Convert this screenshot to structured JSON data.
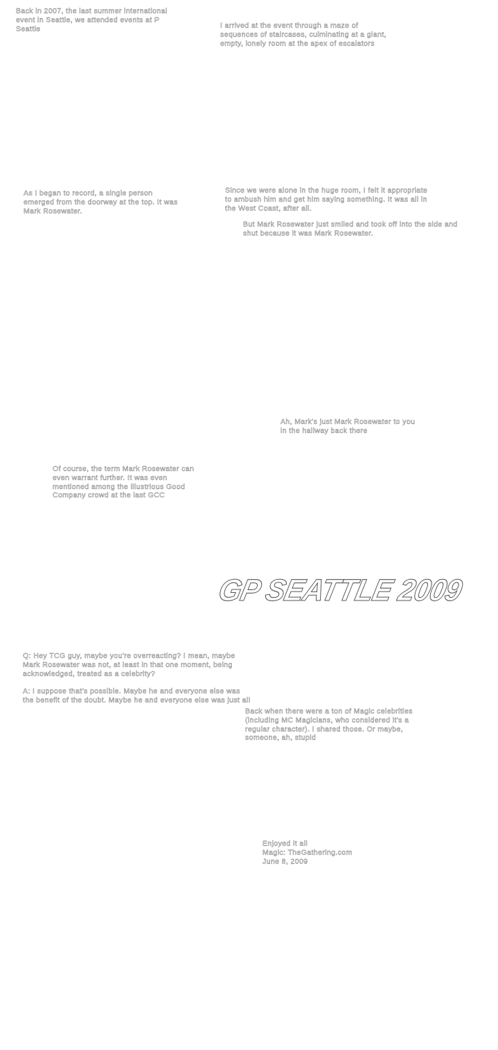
{
  "blocks": {
    "b1": "Back in 2007, the last summer international\nevent in Seattle, we attended events at P\nSeattle",
    "b2": "I arrived at the event through a maze of\nsequences of staircases, culminating at a giant,\nempty, lonely room at the apex of escalators",
    "b3": "As I began to record, a single person\nemerged from the doorway at the top. It was\nMark Rosewater.",
    "b4": "Since we were alone in the huge room, I felt it appropriate\nto ambush him and get him saying something. It was all in\nthe West Coast, after all.",
    "b5": "But Mark Rosewater just smiled and took off into the side and\nshut because it was Mark Rosewater.",
    "b6": "Ah, Mark's just Mark Rosewater to you\nin the hallway back there",
    "b7": "Of course, the term Mark Rosewater can\neven warrant further. It was even\nmentioned among the illustrious Good\nCompany crowd at the last GCC",
    "b8": "Q: Hey TCG guy, maybe you're overreacting? I mean, maybe\nMark Rosewater was not, at least in that one moment, being\nacknowledged, treated as a celebrity?\n\nA: I suppose that's possible. Maybe he and everyone else was\nthe benefit of the doubt. Maybe he and everyone else was just all",
    "b9": "Back when there were a ton of Magic celebrities\n(including MC Magicians, who considered it's a\nregular character). I shared those. Or maybe,\nsomeone, ah, stupid",
    "b10": "Enjoyed it all\nMagic: TheGathering.com\nJune 8, 2009"
  },
  "logo": {
    "text": "GP SEATTLE 2009"
  }
}
